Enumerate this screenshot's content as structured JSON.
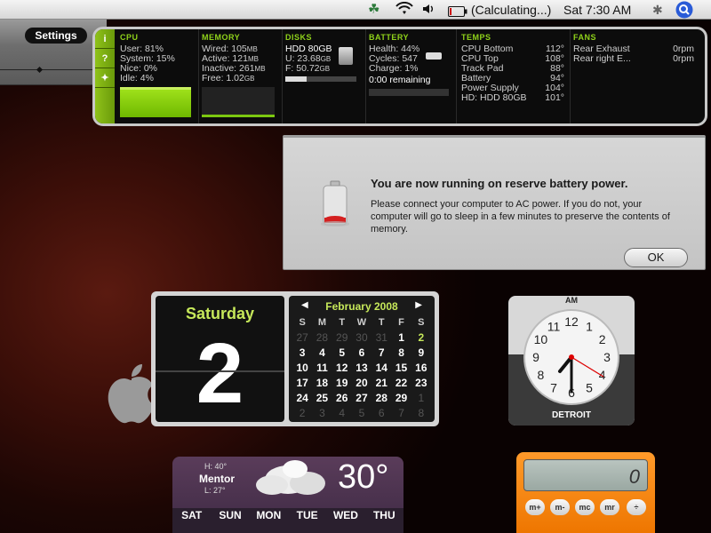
{
  "menubar": {
    "battery_status": "(Calculating...)",
    "clock": "Sat 7:30 AM"
  },
  "dashboard": {
    "settings_label": "Settings"
  },
  "istat": {
    "tabs": [
      "i",
      "?",
      "+"
    ],
    "cpu": {
      "header": "CPU",
      "rows": [
        "User: 81%",
        "System: 15%",
        "Nice: 0%",
        "Idle: 4%"
      ]
    },
    "memory": {
      "header": "MEMORY",
      "rows": [
        {
          "label": "Wired: 105",
          "unit": "MB"
        },
        {
          "label": "Active: 121",
          "unit": "MB"
        },
        {
          "label": "Inactive: 261",
          "unit": "MB"
        },
        {
          "label": "Free: 1.02",
          "unit": "GB"
        }
      ]
    },
    "disks": {
      "header": "DISKS",
      "name": "HDD 80GB",
      "used": "U: 23.68",
      "free": "F: 50.72",
      "unit": "GB"
    },
    "battery": {
      "header": "BATTERY",
      "rows": [
        "Health: 44%",
        "Cycles: 547",
        "Charge: 1%",
        "0:00 remaining"
      ]
    },
    "temps": {
      "header": "TEMPS",
      "rows": [
        {
          "label": "CPU Bottom",
          "value": "112°"
        },
        {
          "label": "CPU Top",
          "value": "108°"
        },
        {
          "label": "Track Pad",
          "value": "88°"
        },
        {
          "label": "Battery",
          "value": "94°"
        },
        {
          "label": "Power Supply",
          "value": "104°"
        },
        {
          "label": "HD: HDD 80GB",
          "value": "101°"
        }
      ]
    },
    "fans": {
      "header": "FANS",
      "rows": [
        {
          "label": "Rear Exhaust",
          "value": "0rpm"
        },
        {
          "label": "Rear right E...",
          "value": "0rpm"
        }
      ]
    }
  },
  "alert": {
    "title": "You are now running on reserve battery power.",
    "body": "Please connect your computer to AC power. If you do not, your computer will go to sleep in a few minutes to preserve the contents of memory.",
    "ok_label": "OK"
  },
  "calendar": {
    "day_name": "Saturday",
    "day_number": "2",
    "month_title": "February 2008",
    "weekday_headers": [
      "S",
      "M",
      "T",
      "W",
      "T",
      "F",
      "S"
    ],
    "weeks": [
      [
        "27",
        "28",
        "29",
        "30",
        "31",
        "1",
        "2"
      ],
      [
        "3",
        "4",
        "5",
        "6",
        "7",
        "8",
        "9"
      ],
      [
        "10",
        "11",
        "12",
        "13",
        "14",
        "15",
        "16"
      ],
      [
        "17",
        "18",
        "19",
        "20",
        "21",
        "22",
        "23"
      ],
      [
        "24",
        "25",
        "26",
        "27",
        "28",
        "29",
        "1"
      ],
      [
        "2",
        "3",
        "4",
        "5",
        "6",
        "7",
        "8"
      ]
    ]
  },
  "clock": {
    "ampm": "AM",
    "city": "DETROIT",
    "numerals": [
      "12",
      "1",
      "2",
      "3",
      "4",
      "5",
      "6",
      "7",
      "8",
      "9",
      "10",
      "11"
    ]
  },
  "weather": {
    "high": "H: 40°",
    "city": "Mentor",
    "low": "L: 27°",
    "temperature": "30°",
    "days": [
      "SAT",
      "SUN",
      "MON",
      "TUE",
      "WED",
      "THU"
    ]
  },
  "calculator": {
    "display": "0",
    "keys": [
      "m+",
      "m-",
      "mc",
      "mr",
      "÷"
    ]
  }
}
